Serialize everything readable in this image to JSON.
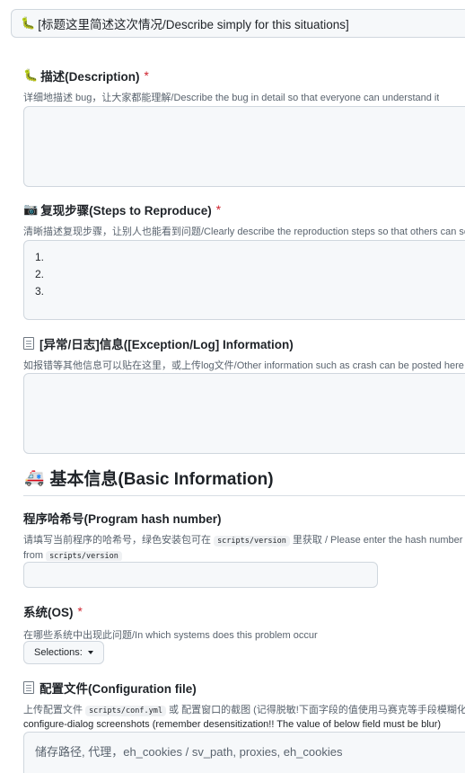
{
  "issue_title": {
    "icon": "🐛",
    "value": "[标题这里简述这次情况/Describe simply for this situations]"
  },
  "description": {
    "icon": "🐛",
    "label": "描述(Description)",
    "required_mark": "*",
    "help": "详细地描述 bug，让大家都能理解/Describe the bug in detail so that everyone can understand it",
    "value": ""
  },
  "steps": {
    "icon": "📷",
    "label": "复现步骤(Steps to Reproduce)",
    "required_mark": "*",
    "help": "清晰描述复现步骤，让别人也能看到问题/Clearly describe the reproduction steps so that others can see the problem",
    "lines": [
      "1.",
      "2.",
      "3."
    ]
  },
  "log": {
    "icon": "document-icon",
    "label": "[异常/日志]信息([Exception/Log] Information)",
    "help": "如报错等其他信息可以贴在这里，或上传log文件/Other information such as crash can be posted here",
    "value": ""
  },
  "basic_info": {
    "icon": "🚑",
    "heading": "基本信息(Basic Information)"
  },
  "hash": {
    "label": "程序哈希号(Program hash number)",
    "help_part1": "请填写当前程序的哈希号，绿色安装包可在",
    "help_code1": "scripts/version",
    "help_part2": "里获取 / Please enter the hash number o",
    "help_part3": "from",
    "help_code2": "scripts/version",
    "value": ""
  },
  "os": {
    "label": "系统(OS)",
    "required_mark": "*",
    "help": "在哪些系统中出现此问题/In which systems does this problem occur",
    "select_label": "Selections:"
  },
  "config": {
    "icon": "document-icon",
    "label": "配置文件(Configuration file)",
    "help_part1": "上传配置文件",
    "help_code": "scripts/conf.yml",
    "help_part2": "或 配置窗口的截图 (记得脱敏!下面字段的值使用马赛克等手段模糊化) /",
    "help_line2": "configure-dialog screenshots (remember desensitization!! The value of below field must be blur)",
    "placeholder": "储存路径, 代理，eh_cookies / sv_path, proxies, eh_cookies"
  }
}
